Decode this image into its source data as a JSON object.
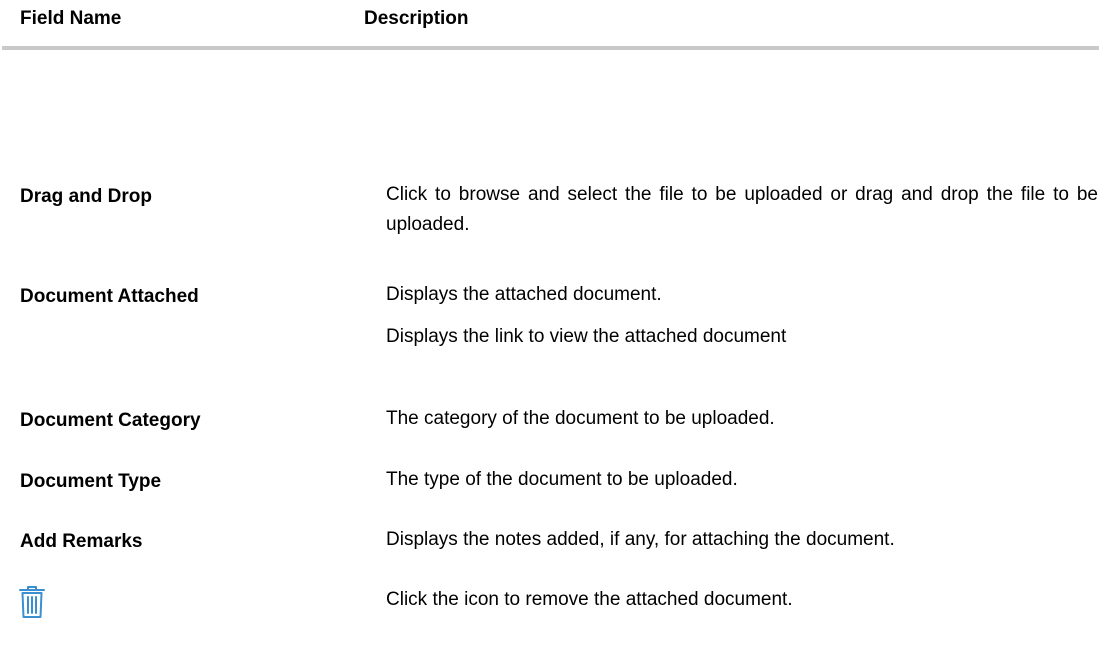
{
  "header": {
    "field_name": "Field Name",
    "description": "Description"
  },
  "rows": [
    {
      "field": "Drag and Drop",
      "desc": [
        "Click to browse and select the file to be uploaded or drag and drop the file to be uploaded."
      ]
    },
    {
      "field": "Document Attached",
      "desc": [
        "Displays the attached document.",
        "Displays the link to view the attached document"
      ]
    },
    {
      "field": "Document Category",
      "desc": [
        "The category of the document to be uploaded."
      ]
    },
    {
      "field": "Document Type",
      "desc": [
        "The type of the document to be uploaded."
      ]
    },
    {
      "field": "Add Remarks",
      "desc": [
        "Displays the notes added, if any, for attaching the document."
      ]
    },
    {
      "icon": "trash-icon",
      "desc": [
        "Click the icon to remove the attached document."
      ]
    }
  ],
  "colors": {
    "rule": "#c9c9c9",
    "icon": "#3a8fd1"
  }
}
